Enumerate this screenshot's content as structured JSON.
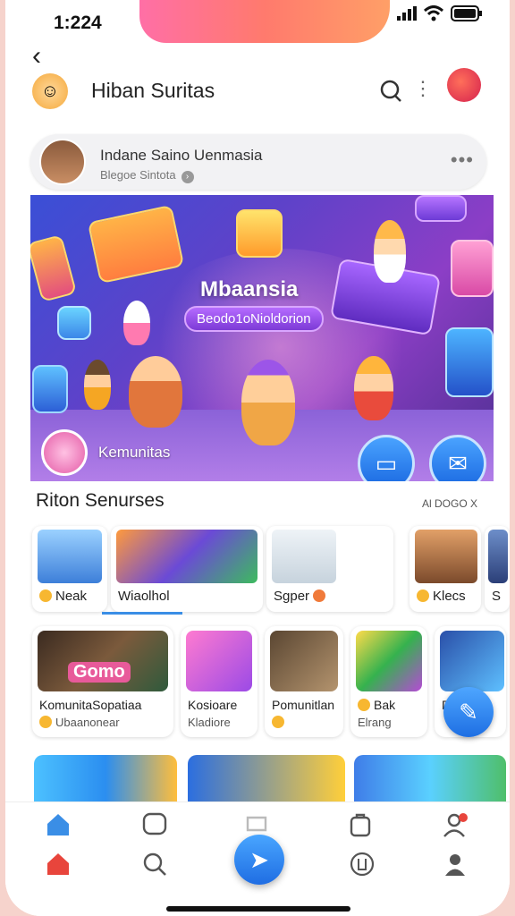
{
  "status_bar": {
    "time": "1:224"
  },
  "header": {
    "title": "Hiban Suritas"
  },
  "profile": {
    "name": "Indane Saino Uenmasia",
    "subtitle": "Blegoe Sintota"
  },
  "hero": {
    "title": "Mbaansia",
    "badge": "Beodo1oNioldorion",
    "community_label": "Kemunitas"
  },
  "section": {
    "title": "Riton Senurses",
    "link": "Al DOGO X"
  },
  "row1": [
    {
      "label": "Neak"
    },
    {
      "label": "Wiaolhol"
    },
    {
      "label": "Sgper"
    },
    {
      "label": "Klecs"
    },
    {
      "label": "S"
    }
  ],
  "row2": [
    {
      "line1": "KomunitaSopatiaa",
      "line2": "Ubaanonear",
      "thumb_text": "Gomo"
    },
    {
      "line1": "Kosioare",
      "line2": "Kladiore"
    },
    {
      "line1": "Pomunitlan",
      "line2": ""
    },
    {
      "line1": "Bak",
      "line2": "Elrang"
    },
    {
      "line1": "Dri",
      "line2": ""
    }
  ],
  "colors": {
    "accent": "#1f6de3",
    "notch_gradient": "#ff6fa6",
    "home_active": "#e8453c"
  },
  "icons": [
    "back-icon",
    "search-icon",
    "more-icon",
    "chat-icon",
    "share-icon",
    "home-icon",
    "search-nav-icon",
    "bag-icon",
    "person-icon"
  ]
}
